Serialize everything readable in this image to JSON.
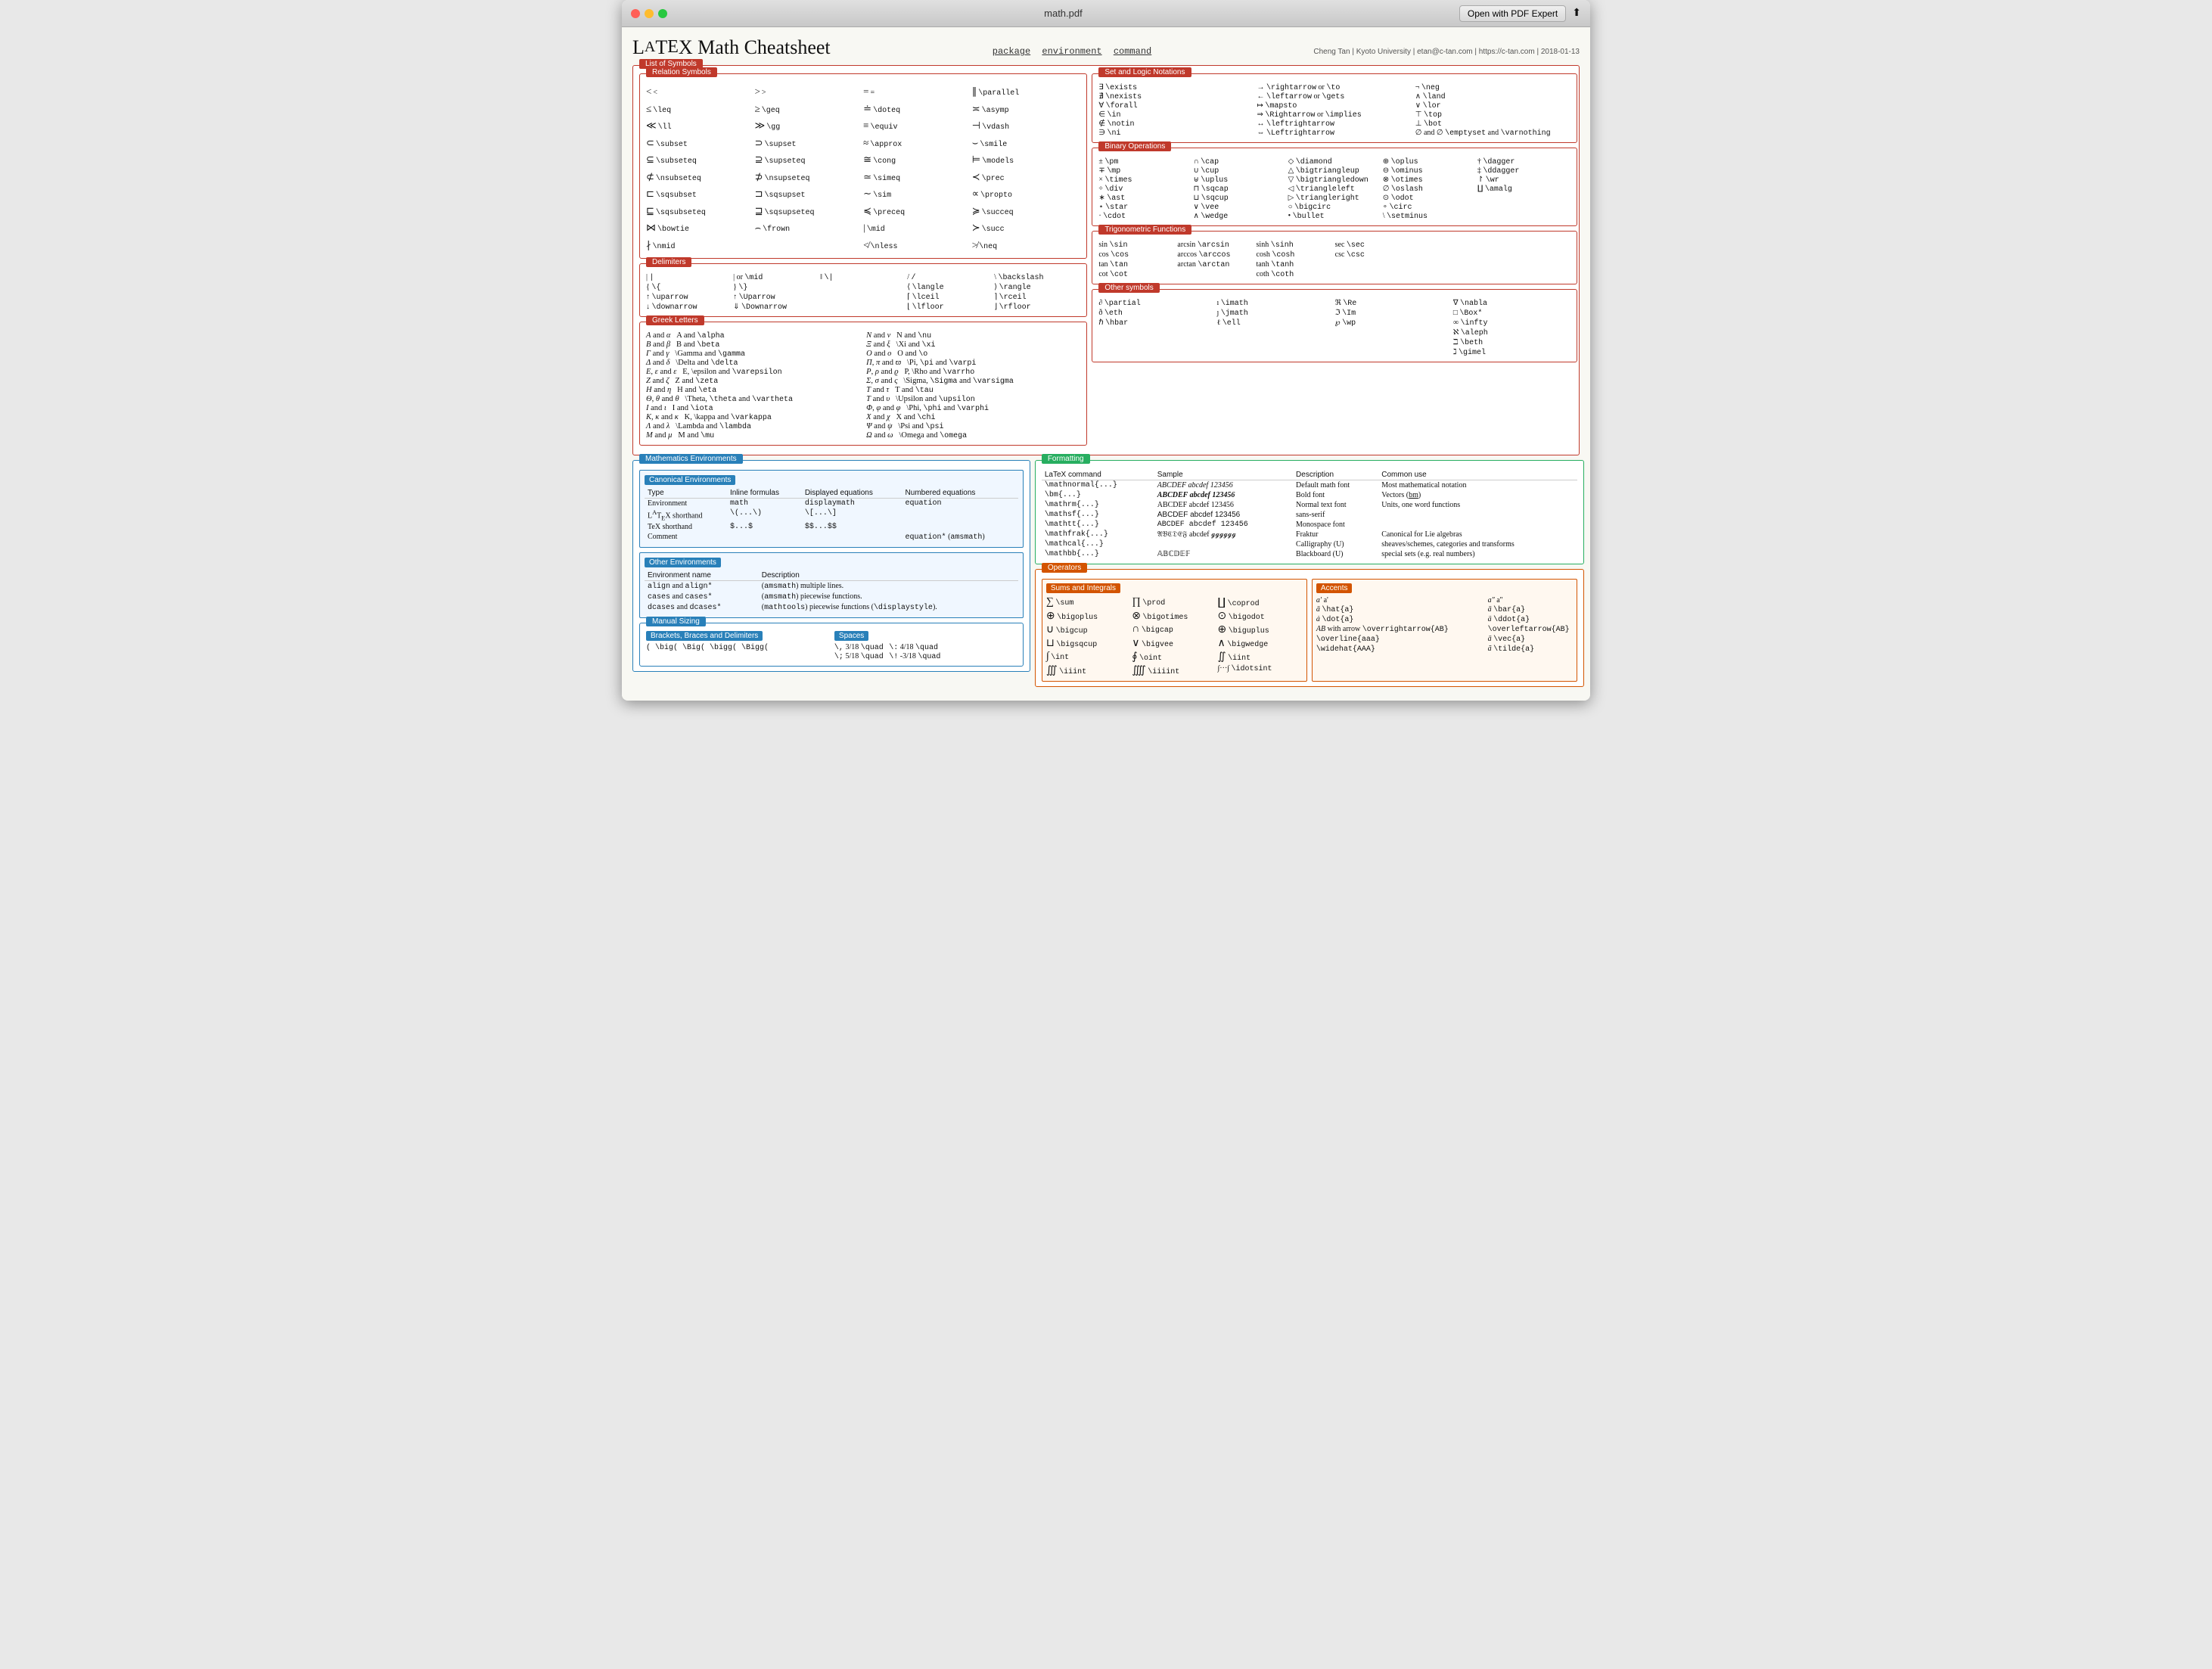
{
  "window": {
    "title": "math.pdf",
    "open_button": "Open with PDF Expert"
  },
  "header": {
    "title_pre": "L",
    "title_a": "A",
    "title_tex": "T",
    "title_e": "E",
    "title_x_main": "X Math Cheatsheet",
    "subtitle_package": "package",
    "subtitle_env": "environment",
    "subtitle_cmd": "command",
    "author": "Cheng Tan | Kyoto University | etan@c-tan.com | https://c-tan.com | 2018-01-13"
  },
  "sections": {
    "list_of_symbols": "List of Symbols",
    "relation": "Relation Symbols",
    "delimiters": "Delimiters",
    "greek": "Greek Letters",
    "set_logic": "Set and Logic Notations",
    "binary": "Binary Operations",
    "trig": "Trigonometric Functions",
    "other": "Other symbols",
    "math_env": "Mathematics Environments",
    "canonical_env": "Canonical Environments",
    "other_env": "Other Environments",
    "manual_sizing": "Manual Sizing",
    "formatting": "Formatting",
    "operators": "Operators",
    "sums": "Sums and Integrals",
    "accents": "Accents"
  }
}
